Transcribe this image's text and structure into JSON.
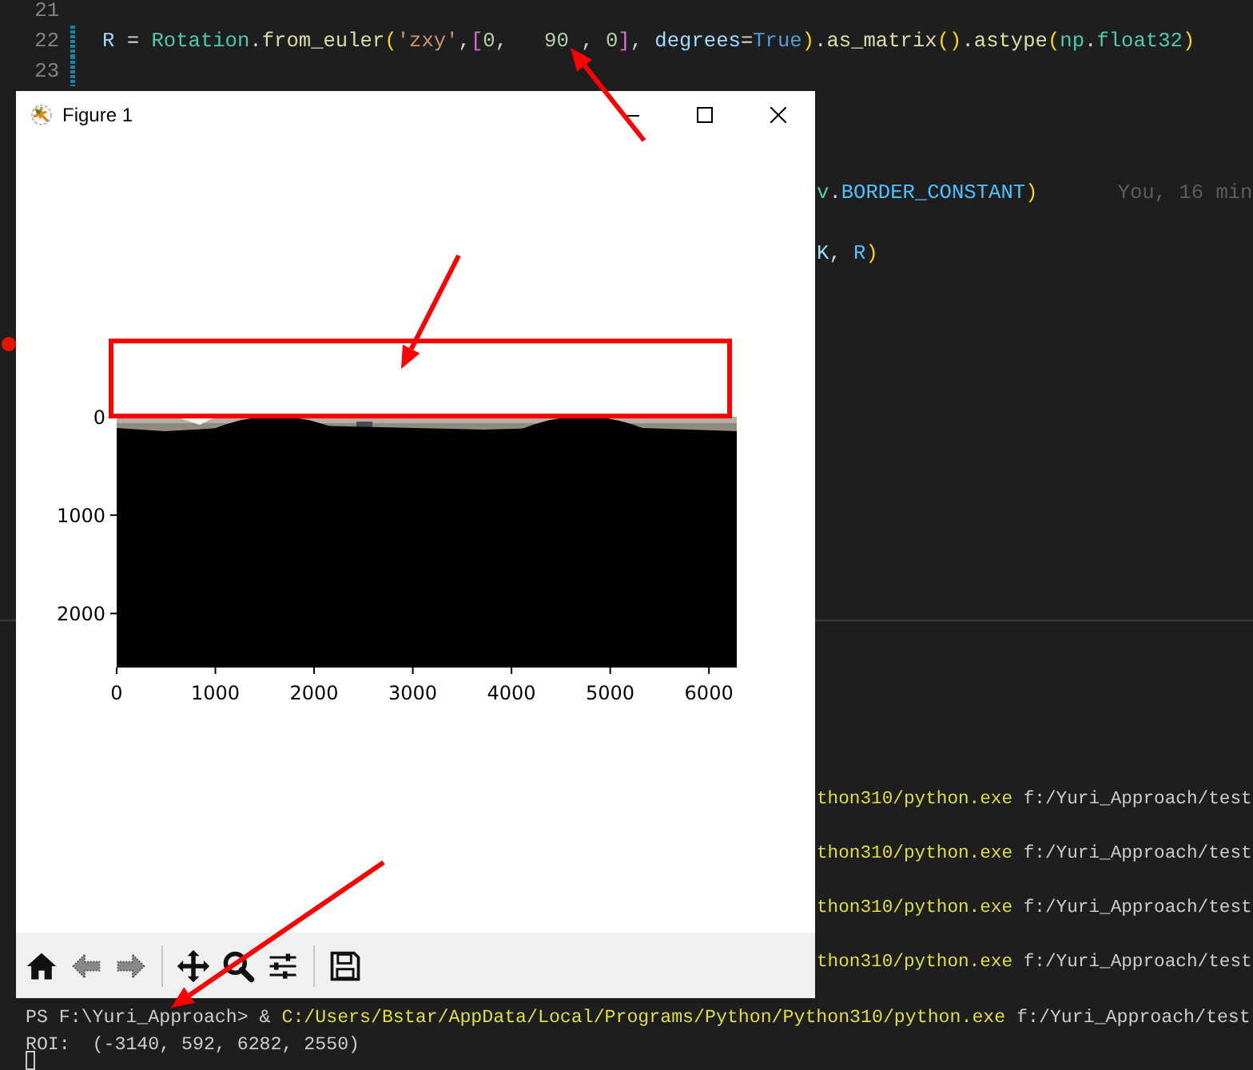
{
  "editor": {
    "lines": [
      {
        "number": "21",
        "modified": false
      },
      {
        "number": "22",
        "modified": true,
        "tokens": [
          {
            "text": "R",
            "kind": "var"
          },
          {
            "text": " = ",
            "kind": "op"
          },
          {
            "text": "Rotation",
            "kind": "cls"
          },
          {
            "text": ".",
            "kind": "plain"
          },
          {
            "text": "from_euler",
            "kind": "fn"
          },
          {
            "text": "(",
            "kind": "br1"
          },
          {
            "text": "'zxy'",
            "kind": "str"
          },
          {
            "text": ",",
            "kind": "plain"
          },
          {
            "text": "[",
            "kind": "br2"
          },
          {
            "text": "0",
            "kind": "num"
          },
          {
            "text": ",   ",
            "kind": "plain"
          },
          {
            "text": "90",
            "kind": "num"
          },
          {
            "text": " , ",
            "kind": "plain"
          },
          {
            "text": "0",
            "kind": "num"
          },
          {
            "text": "]",
            "kind": "br2"
          },
          {
            "text": ", ",
            "kind": "plain"
          },
          {
            "text": "degrees",
            "kind": "var"
          },
          {
            "text": "=",
            "kind": "op"
          },
          {
            "text": "True",
            "kind": "kw"
          },
          {
            "text": ")",
            "kind": "br1"
          },
          {
            "text": ".",
            "kind": "plain"
          },
          {
            "text": "as_matrix",
            "kind": "fn"
          },
          {
            "text": "()",
            "kind": "br1"
          },
          {
            "text": ".",
            "kind": "plain"
          },
          {
            "text": "astype",
            "kind": "fn"
          },
          {
            "text": "(",
            "kind": "br1"
          },
          {
            "text": "np",
            "kind": "cls"
          },
          {
            "text": ".",
            "kind": "plain"
          },
          {
            "text": "float32",
            "kind": "cls"
          },
          {
            "text": ")",
            "kind": "br1"
          }
        ]
      },
      {
        "number": "23",
        "modified": true
      }
    ],
    "partial_lines": [
      {
        "tokens": [
          {
            "text": "v",
            "kind": "cls"
          },
          {
            "text": ".",
            "kind": "plain"
          },
          {
            "text": "BORDER_CONSTANT",
            "kind": "const"
          },
          {
            "text": ")",
            "kind": "br1"
          }
        ],
        "blame": "You, 16 min"
      },
      {
        "tokens": [
          {
            "text": "K",
            "kind": "var"
          },
          {
            "text": ", ",
            "kind": "plain"
          },
          {
            "text": "R",
            "kind": "const"
          },
          {
            "text": ")",
            "kind": "br1"
          }
        ]
      }
    ],
    "breakpoint": true
  },
  "figure_window": {
    "title": "Figure 1",
    "axes": {
      "yticks": [
        "0",
        "1000",
        "2000"
      ],
      "xticks": [
        "0",
        "1000",
        "2000",
        "3000",
        "4000",
        "5000",
        "6000"
      ]
    },
    "toolbar": [
      {
        "kind": "home"
      },
      {
        "kind": "back"
      },
      {
        "kind": "forward"
      },
      {
        "kind": "separator"
      },
      {
        "kind": "move"
      },
      {
        "kind": "zoom"
      },
      {
        "kind": "configure"
      },
      {
        "kind": "separator"
      },
      {
        "kind": "save"
      }
    ]
  },
  "terminal": {
    "partial_lines": [
      {
        "tokens": [
          {
            "text": "thon310/python.exe",
            "kind": "path"
          },
          {
            "text": " f:/Yuri_Approach/test",
            "kind": "arg"
          }
        ]
      },
      {
        "tokens": [
          {
            "text": "thon310/python.exe",
            "kind": "path"
          },
          {
            "text": " f:/Yuri_Approach/test",
            "kind": "arg"
          }
        ]
      },
      {
        "tokens": [
          {
            "text": "thon310/python.exe",
            "kind": "path"
          },
          {
            "text": " f:/Yuri_Approach/test",
            "kind": "arg"
          }
        ]
      },
      {
        "tokens": [
          {
            "text": "thon310/python.exe",
            "kind": "path"
          },
          {
            "text": " f:/Yuri_Approach/test",
            "kind": "arg"
          }
        ]
      }
    ],
    "lines": [
      {
        "tokens": [
          {
            "text": "PS F:\\Yuri_Approach> & ",
            "kind": "arg"
          },
          {
            "text": "C:/Users/Bstar/AppData/Local/Programs/Python/Python310/python.exe",
            "kind": "path"
          },
          {
            "text": " f:/Yuri_Approach/test",
            "kind": "arg"
          }
        ]
      },
      {
        "tokens": [
          {
            "text": "ROI:  (-3140, 592, 6282, 2550)",
            "kind": "arg"
          }
        ]
      }
    ],
    "cursor": true
  }
}
